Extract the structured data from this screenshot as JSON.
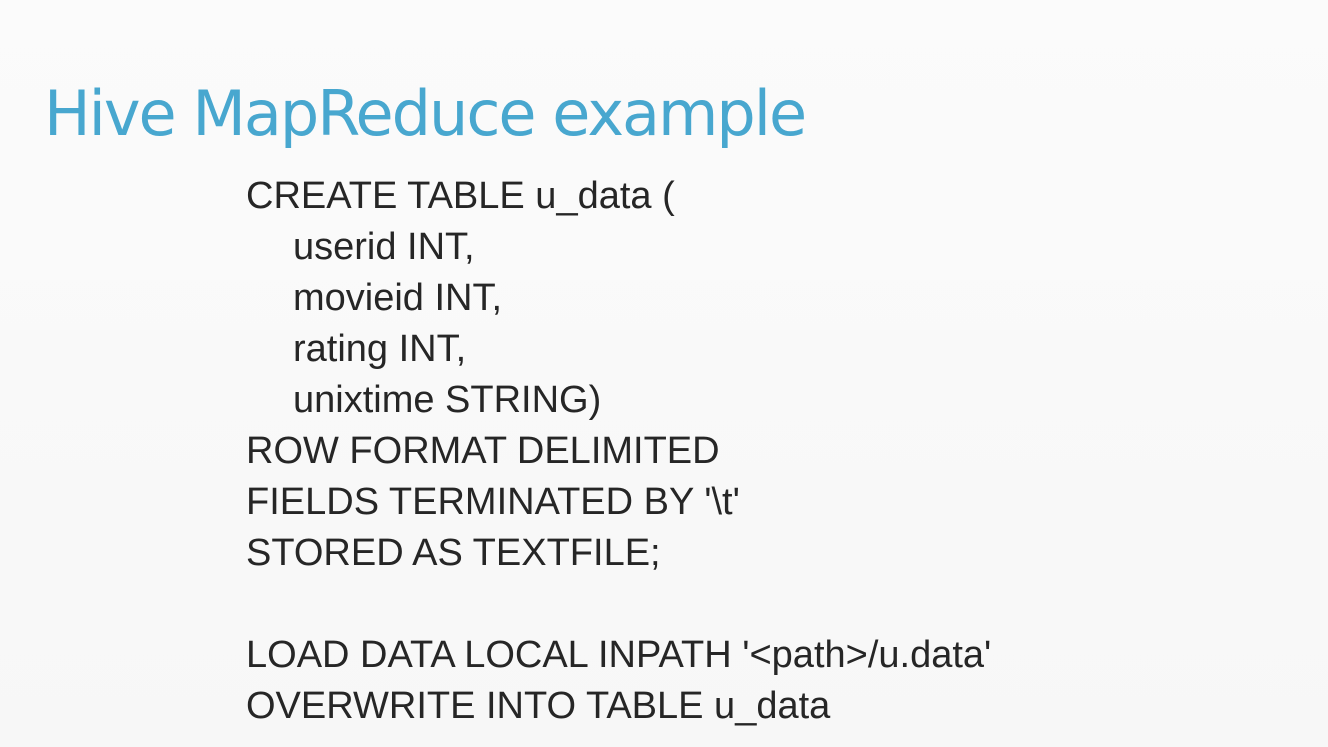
{
  "slide": {
    "title": "Hive MapReduce example",
    "code_lines": [
      "CREATE TABLE u_data (",
      "userid INT,",
      "movieid INT,",
      "rating INT,",
      "unixtime STRING)",
      "ROW FORMAT DELIMITED",
      "FIELDS TERMINATED BY '\\t'",
      "STORED AS TEXTFILE;",
      "",
      "LOAD DATA LOCAL INPATH '<path>/u.data'",
      "OVERWRITE INTO TABLE u_data"
    ]
  },
  "colors": {
    "title": "#48a7cf",
    "text": "#262626",
    "background": "#fafafa"
  }
}
